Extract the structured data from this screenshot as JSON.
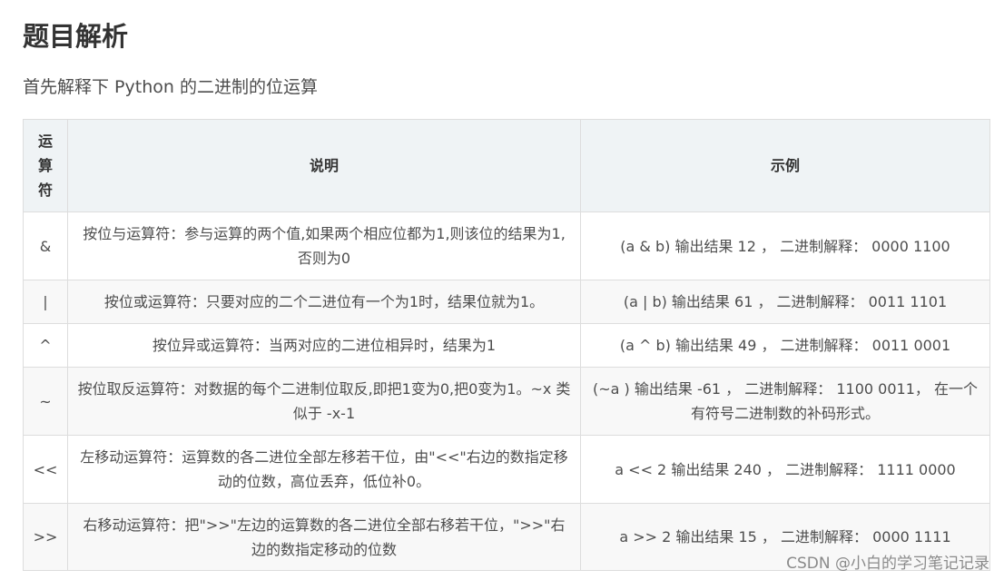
{
  "heading": "题目解析",
  "intro": "首先解释下 Python 的二进制的位运算",
  "table": {
    "headers": [
      "运算符",
      "说明",
      "示例"
    ],
    "rows": [
      {
        "op": "&",
        "desc": "按位与运算符：参与运算的两个值,如果两个相应位都为1,则该位的结果为1,否则为0",
        "example": "(a & b) 输出结果 12 ， 二进制解释： 0000 1100"
      },
      {
        "op": "|",
        "desc": "按位或运算符：只要对应的二个二进位有一个为1时，结果位就为1。",
        "example": "(a | b) 输出结果 61 ， 二进制解释： 0011 1101"
      },
      {
        "op": "^",
        "desc": "按位异或运算符：当两对应的二进位相异时，结果为1",
        "example": "(a ^ b) 输出结果 49 ， 二进制解释： 0011 0001"
      },
      {
        "op": "~",
        "desc": "按位取反运算符：对数据的每个二进制位取反,即把1变为0,把0变为1。~x 类似于 -x-1",
        "example": "(~a ) 输出结果 -61 ， 二进制解释： 1100 0011， 在一个有符号二进制数的补码形式。"
      },
      {
        "op": "<<",
        "desc": "左移动运算符：运算数的各二进位全部左移若干位，由\"<<\"右边的数指定移动的位数，高位丢弃，低位补0。",
        "example": "a << 2 输出结果 240 ， 二进制解释： 1111 0000"
      },
      {
        "op": ">>",
        "desc": "右移动运算符：把\">>\"左边的运算数的各二进位全部右移若干位，\">>\"右边的数指定移动的位数",
        "example": "a >> 2 输出结果 15 ， 二进制解释： 0000 1111"
      }
    ]
  },
  "watermark": "CSDN @小白的学习笔记记录"
}
